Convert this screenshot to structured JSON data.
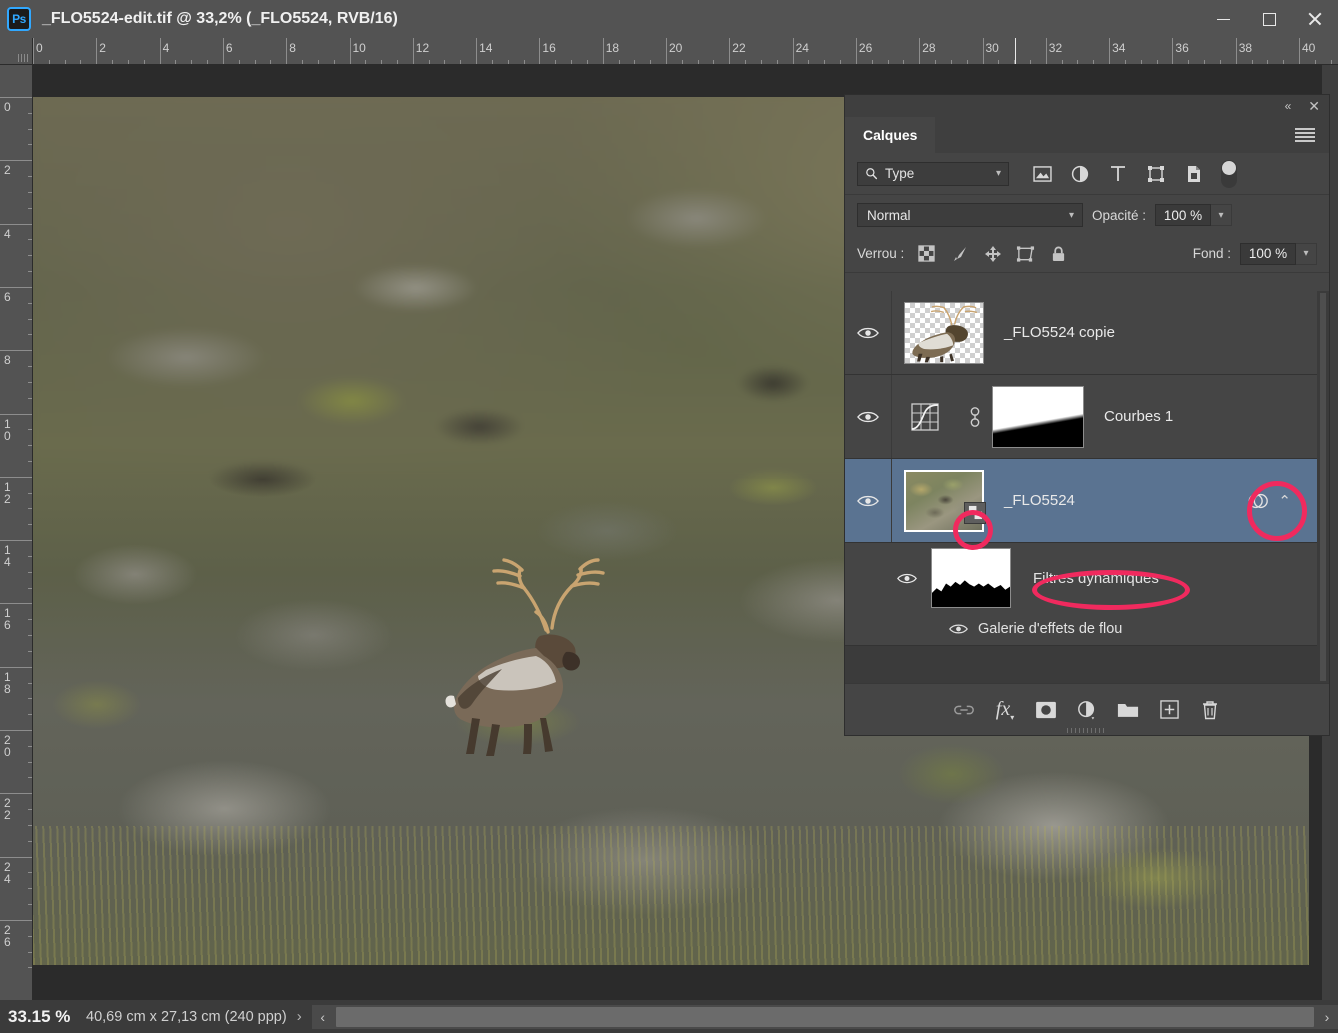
{
  "window": {
    "title": "_FLO5524-edit.tif @ 33,2% (_FLO5524, RVB/16)",
    "app_icon": "photoshop-icon",
    "app_icon_text": "Ps",
    "minimize": "minimize-icon",
    "maximize": "maximize-icon",
    "close": "close-icon"
  },
  "rulers": {
    "unit": "cm",
    "horizontal_labels": [
      "0",
      "2",
      "4",
      "6",
      "8",
      "10",
      "12",
      "14",
      "16",
      "18",
      "20",
      "22",
      "24",
      "26",
      "28",
      "30",
      "32",
      "34",
      "36",
      "38",
      "40"
    ],
    "vertical_labels": [
      "0",
      "2",
      "4",
      "6",
      "8",
      "10",
      "12",
      "14",
      "16",
      "18",
      "20",
      "22",
      "24",
      "26"
    ]
  },
  "statusbar": {
    "zoom": "33.15 %",
    "dimensions": "40,69 cm x 27,13 cm (240 ppp)",
    "expand_arrow": "›",
    "scroll_left": "‹",
    "scroll_right": "›"
  },
  "panel": {
    "tab_label": "Calques",
    "collapse_icon": "collapse-double-chevron-icon",
    "close_icon": "close-icon",
    "menu_icon": "panel-menu-icon",
    "filter": {
      "search_icon": "search-icon",
      "label": "Type",
      "chevron": "⌄",
      "icons": [
        {
          "name": "filter-pixel-icon"
        },
        {
          "name": "filter-adjustment-icon"
        },
        {
          "name": "filter-type-icon"
        },
        {
          "name": "filter-shape-icon"
        },
        {
          "name": "filter-smartobject-icon"
        }
      ],
      "toggle": "filter-enable-toggle"
    },
    "blend_mode": "Normal",
    "opacity_label": "Opacité :",
    "opacity_value": "100 %",
    "lock_label": "Verrou :",
    "lock_icons": [
      {
        "name": "lock-transparency-icon"
      },
      {
        "name": "lock-image-icon"
      },
      {
        "name": "lock-position-icon"
      },
      {
        "name": "lock-artboard-icon"
      },
      {
        "name": "lock-all-icon"
      }
    ],
    "fill_label": "Fond :",
    "fill_value": "100 %",
    "layers": [
      {
        "name": "_FLO5524 copie",
        "visible": true,
        "thumb": "transparent-deer-thumb",
        "selected": false,
        "type": "pixel"
      },
      {
        "name": "Courbes 1",
        "visible": true,
        "thumb": "curves-gradient-mask",
        "adjustment_icon": "curves-icon",
        "link_icon": "link-mask-icon",
        "selected": false,
        "type": "adjustment"
      },
      {
        "name": "_FLO5524",
        "visible": true,
        "thumb": "rocky-landscape-thumb",
        "smart_object_badge": "smart-object-badge-icon",
        "smart_filter_indicator": "smart-filter-icon",
        "collapse_chevron": "⌃",
        "selected": true,
        "type": "smart-object"
      }
    ],
    "smart_filters": {
      "title": "Filtres dynamiques",
      "mask": "smart-filter-mask",
      "visible": true,
      "effects": [
        {
          "name": "Galerie d'effets de flou",
          "visible": true
        }
      ]
    },
    "footer_buttons": [
      {
        "name": "link-layers-button",
        "icon": "link-icon",
        "label": "⚭"
      },
      {
        "name": "layer-style-button",
        "icon": "fx-icon",
        "label": "fx"
      },
      {
        "name": "add-mask-button",
        "icon": "mask-icon"
      },
      {
        "name": "new-adjustment-button",
        "icon": "adjustment-icon"
      },
      {
        "name": "new-group-button",
        "icon": "folder-icon"
      },
      {
        "name": "new-layer-button",
        "icon": "plus-square-icon"
      },
      {
        "name": "delete-layer-button",
        "icon": "trash-icon"
      }
    ]
  },
  "annotations": {
    "highlight_color": "#f02a5e",
    "targets": [
      "smart-object-badge",
      "smart-filter-indicator",
      "filtres-dynamiques-label"
    ]
  }
}
